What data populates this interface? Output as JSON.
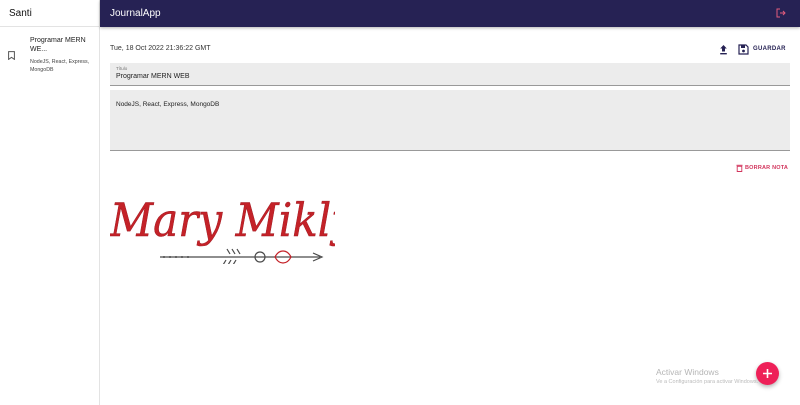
{
  "sidebar": {
    "user_name": "Santi",
    "entries": [
      {
        "title": "Programar MERN WE...",
        "body": "NodeJS, React, Express, MongoDB",
        "icon": "bookmark-icon"
      }
    ]
  },
  "appbar": {
    "title": "JournalApp",
    "background": "#262254",
    "logout_icon": "logout-icon"
  },
  "note": {
    "date": "Tue, 18 Oct 2022 21:36:22 GMT",
    "upload_icon": "upload-icon",
    "save_label": "GUARDAR",
    "save_icon": "save-icon",
    "title_label": "Título",
    "title_value": "Programar MERN WEB",
    "body_value": "NodeJS, React, Express, MongoDB",
    "delete_label": "BORRAR NOTA",
    "delete_icon": "trash-icon",
    "image_text": "Mary Mikly"
  },
  "watermark": {
    "line1": "Activar Windows",
    "line2": "Ve a Configuración para activar Windows."
  },
  "fab": {
    "icon": "plus-icon",
    "color": "#ee2058"
  },
  "colors": {
    "accent": "#ee2058",
    "delete": "#d2345c",
    "primary": "#262254"
  }
}
